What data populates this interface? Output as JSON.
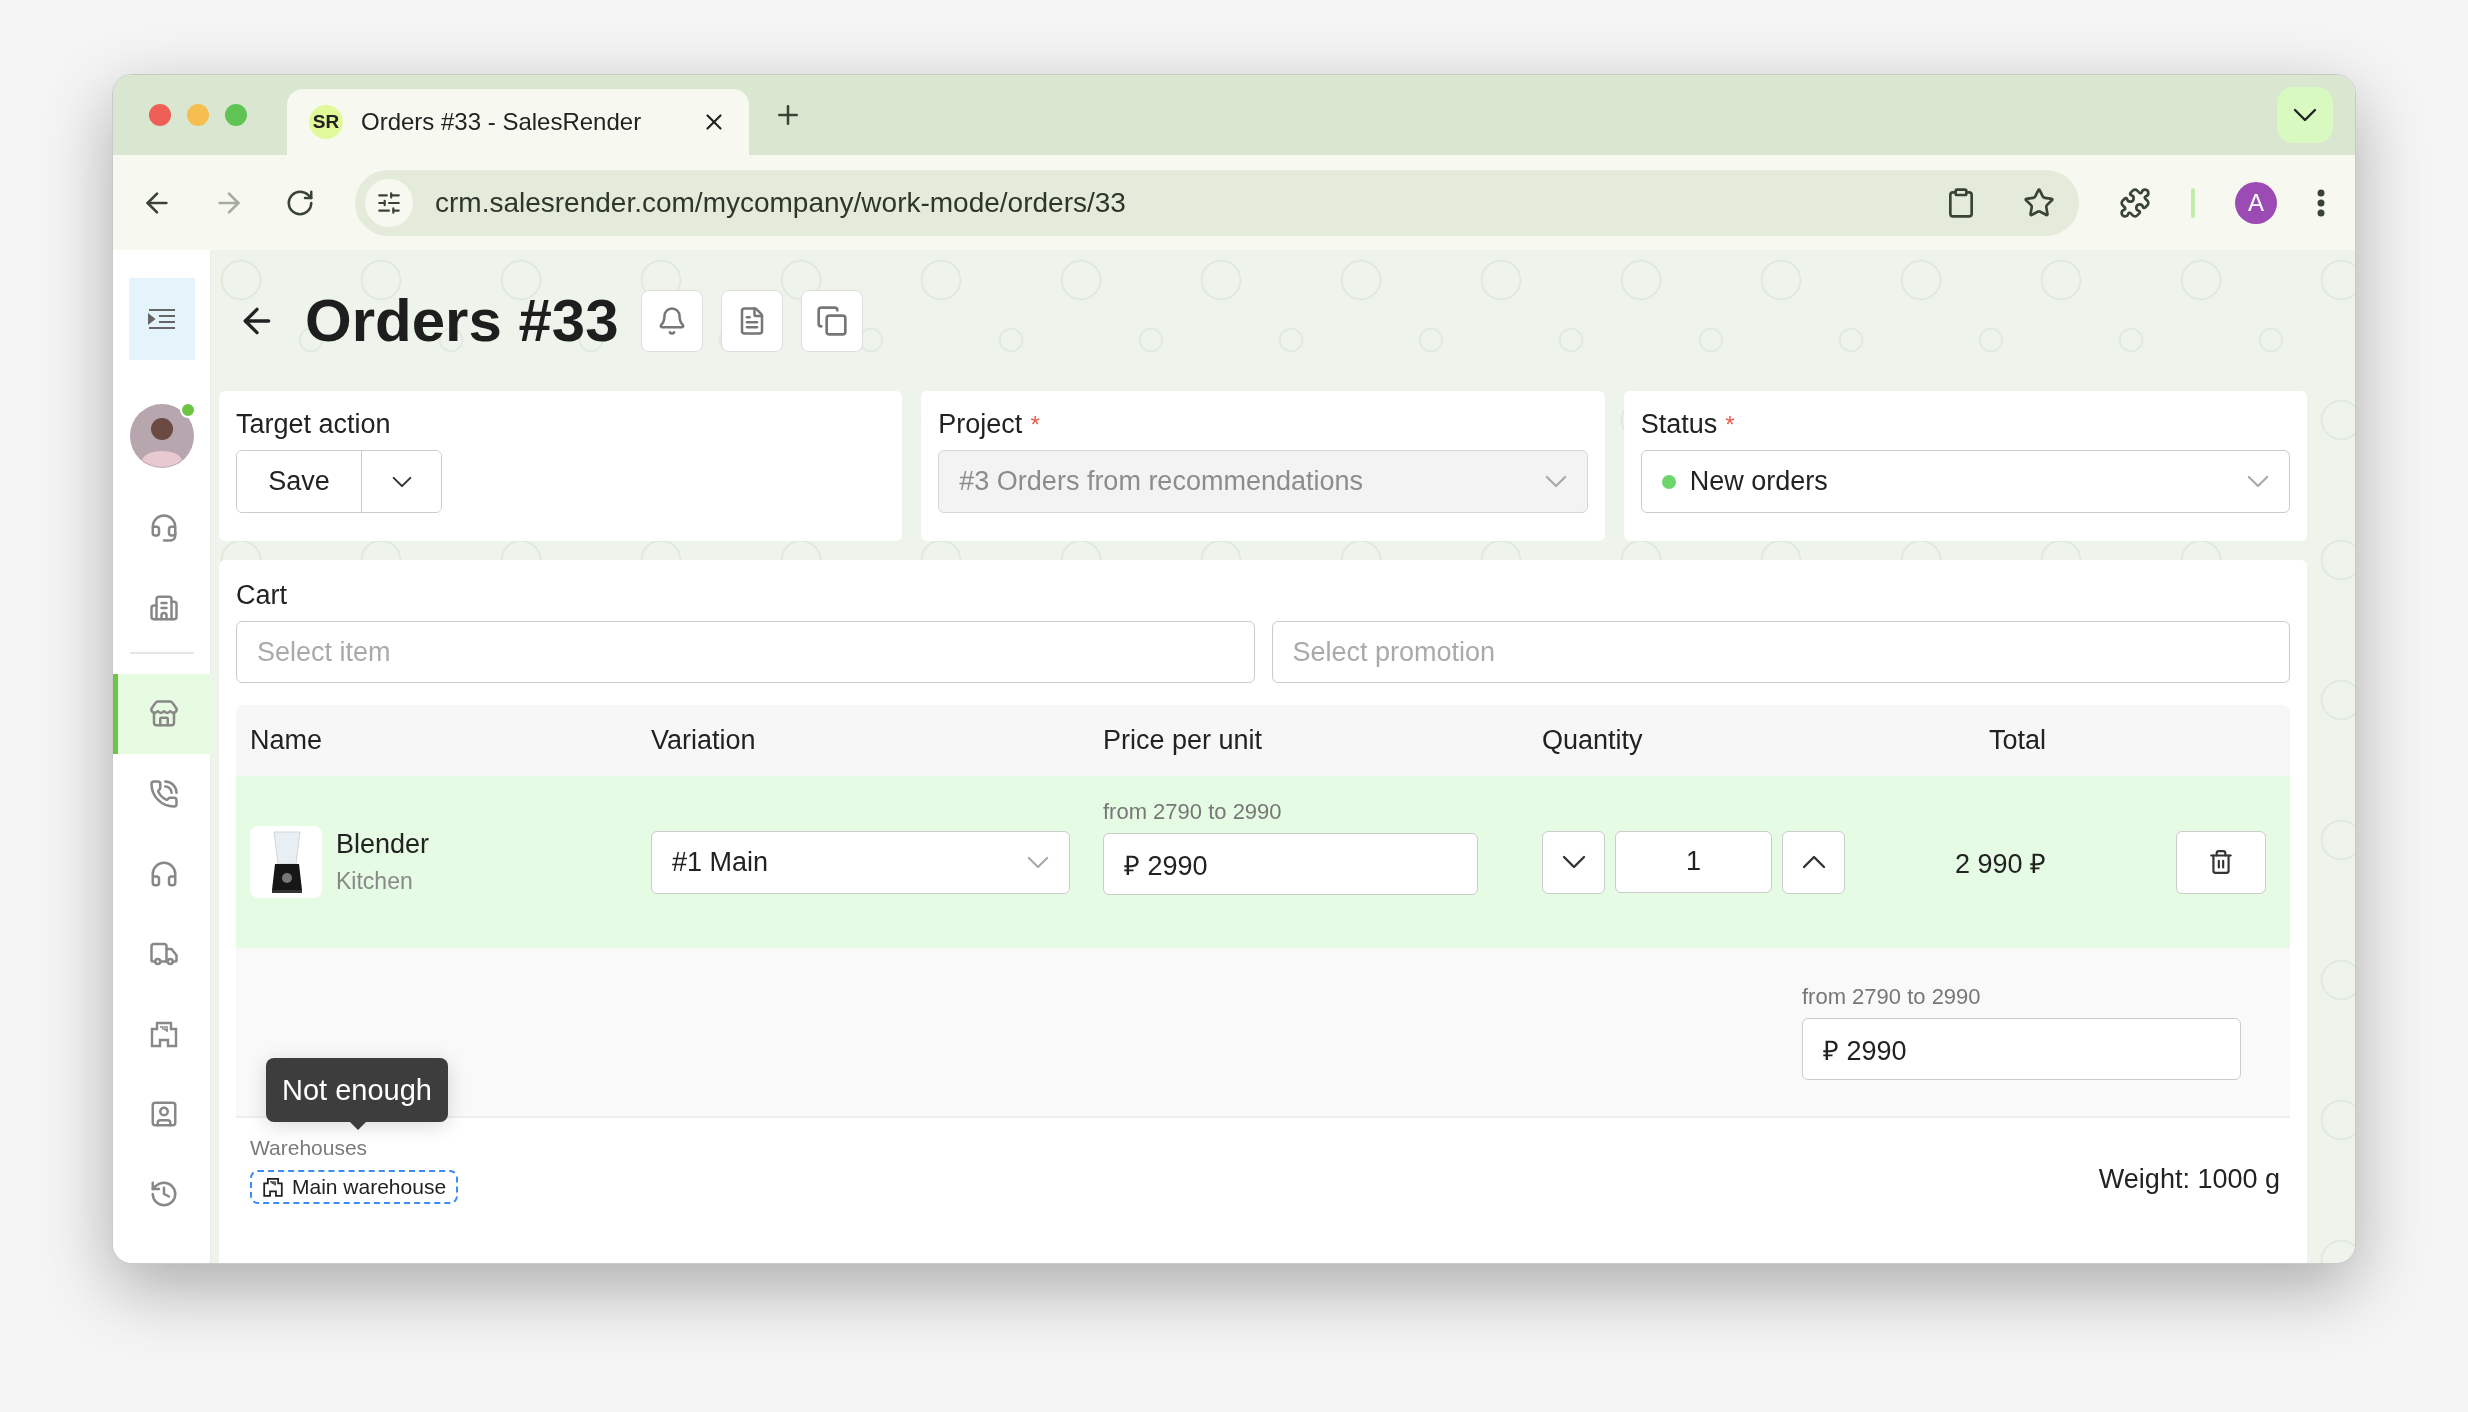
{
  "browser": {
    "favicon": "SR",
    "tab_title": "Orders #33 - SalesRender",
    "can_go_forward": false,
    "url": "crm.salesrender.com/mycompany/work-mode/orders/33",
    "profile_initial": "A"
  },
  "sidebar": {
    "avatar": {
      "online": true
    },
    "top_items": [
      {
        "kind": "headset",
        "selected": false
      },
      {
        "kind": "building",
        "selected": false
      }
    ],
    "nav_items": [
      {
        "kind": "store",
        "selected": true
      },
      {
        "kind": "phone",
        "selected": false
      },
      {
        "kind": "headphones",
        "selected": false
      },
      {
        "kind": "truck",
        "selected": false
      },
      {
        "kind": "store24",
        "selected": false
      },
      {
        "kind": "contact",
        "selected": false
      },
      {
        "kind": "history",
        "selected": false
      }
    ]
  },
  "page": {
    "title": "Orders #33"
  },
  "target_action": {
    "label": "Target action",
    "button": "Save"
  },
  "project": {
    "label": "Project",
    "required_mark": "*",
    "value": "#3 Orders from recommendations",
    "disabled": true
  },
  "status": {
    "label": "Status",
    "required_mark": "*",
    "value": "New orders",
    "color": "#6cd66c"
  },
  "cart": {
    "label": "Cart",
    "item_placeholder": "Select item",
    "promotion_placeholder": "Select promotion",
    "columns": [
      "Name",
      "Variation",
      "Price per unit",
      "Quantity",
      "Total"
    ],
    "rows": [
      {
        "name": "Blender",
        "category": "Kitchen",
        "variation": "#1 Main",
        "price_hint": "from 2790 to 2990",
        "price": "₽ 2990",
        "quantity": "1",
        "total": "2 990 ₽"
      }
    ],
    "extra_price": {
      "hint": "from 2790 to 2990",
      "value": "₽ 2990"
    },
    "warehouses_label": "Warehouses",
    "warehouse": "Main warehouse",
    "tooltip": "Not enough",
    "weight": "Weight: 1000 g"
  }
}
